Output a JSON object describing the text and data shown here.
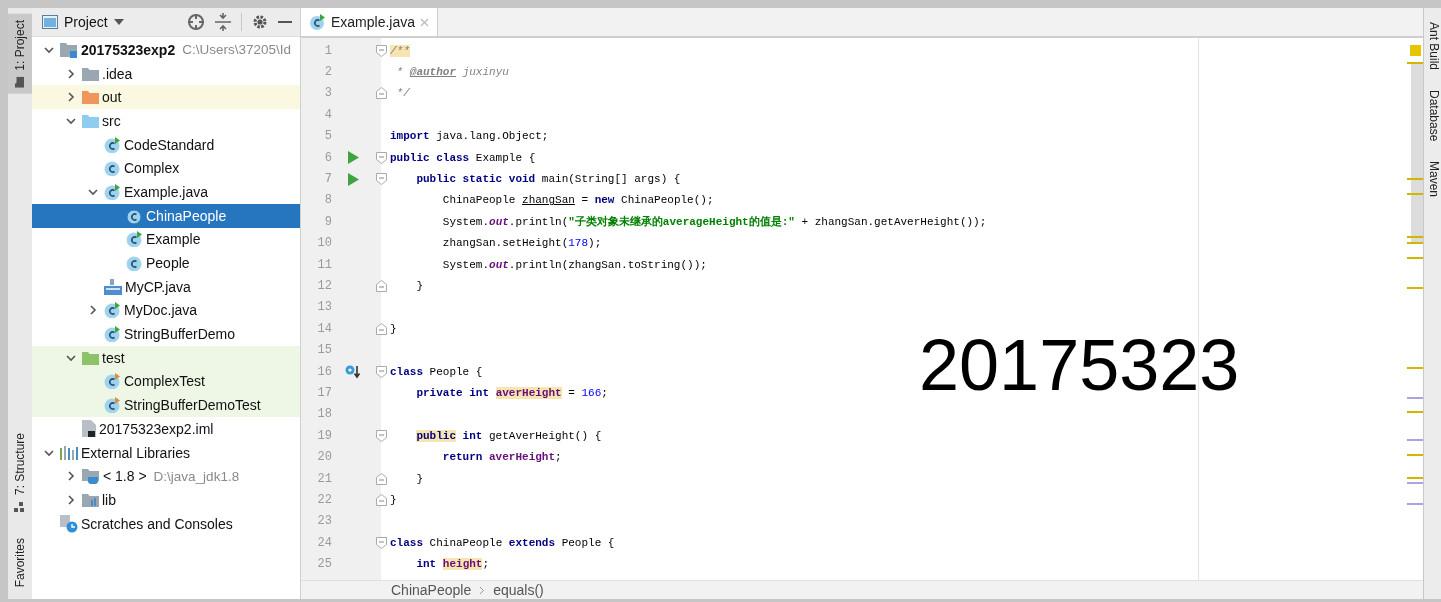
{
  "left_tool_strip": {
    "tool_windows": [
      {
        "label": "1: Project",
        "kind": "project",
        "selected": true
      },
      {
        "label": "7: Structure",
        "kind": "structure",
        "selected": false
      },
      {
        "label": "Favorites",
        "kind": "favorites",
        "selected": false
      }
    ]
  },
  "project_panel": {
    "title": "Project",
    "tree": [
      {
        "label": "20175323exp2",
        "path": "C:\\Users\\37205\\Id",
        "kind": "module",
        "expanded": true,
        "selected": false,
        "children": [
          {
            "label": ".idea",
            "kind": "folder",
            "expanded": false,
            "selected": false
          },
          {
            "label": "out",
            "kind": "folder-excluded",
            "excluded": true,
            "expanded": false,
            "selected": false
          },
          {
            "label": "src",
            "kind": "folder-src",
            "expanded": true,
            "selected": false,
            "children": [
              {
                "label": "CodeStandard",
                "kind": "class-run",
                "selected": false
              },
              {
                "label": "Complex",
                "kind": "class",
                "selected": false
              },
              {
                "label": "Example.java",
                "kind": "class-run",
                "expanded": true,
                "selected": false,
                "children": [
                  {
                    "label": "ChinaPeople",
                    "kind": "class",
                    "selected": true
                  },
                  {
                    "label": "Example",
                    "kind": "class-run",
                    "selected": false
                  },
                  {
                    "label": "People",
                    "kind": "class",
                    "selected": false
                  }
                ]
              },
              {
                "label": "MyCP.java",
                "kind": "java-file",
                "selected": false
              },
              {
                "label": "MyDoc.java",
                "kind": "class-run",
                "expanded": false,
                "selected": false
              },
              {
                "label": "StringBufferDemo",
                "kind": "class-run",
                "selected": false
              }
            ]
          },
          {
            "label": "test",
            "kind": "folder-test",
            "test_source": true,
            "expanded": true,
            "selected": false,
            "children": [
              {
                "label": "ComplexTest",
                "kind": "class-test",
                "test_source": true,
                "selected": false
              },
              {
                "label": "StringBufferDemoTest",
                "kind": "class-test",
                "test_source": true,
                "selected": false
              }
            ]
          },
          {
            "label": "20175323exp2.iml",
            "kind": "iml",
            "selected": false
          }
        ]
      },
      {
        "label": "External Libraries",
        "kind": "library",
        "expanded": true,
        "selected": false,
        "children": [
          {
            "label": "< 1.8 >",
            "path": "D:\\java_jdk1.8",
            "kind": "jdk",
            "expanded": false,
            "selected": false
          },
          {
            "label": "lib",
            "kind": "lib-folder",
            "expanded": false,
            "selected": false
          }
        ]
      },
      {
        "label": "Scratches and Consoles",
        "kind": "scratches",
        "selected": false
      }
    ]
  },
  "editor": {
    "tabs": [
      {
        "label": "Example.java",
        "selected": true
      }
    ],
    "lines": [
      {
        "n": "1",
        "fold_start": true,
        "tokens": [
          {
            "t": "/**",
            "kind": "comment",
            "hl": true
          }
        ]
      },
      {
        "n": "2",
        "tokens": [
          {
            "t": " * ",
            "kind": "comment"
          },
          {
            "t": "@author",
            "kind": "tag"
          },
          {
            "t": " juxinyu",
            "kind": "comment"
          }
        ]
      },
      {
        "n": "3",
        "fold_end": true,
        "tokens": [
          {
            "t": " */",
            "kind": "comment"
          }
        ]
      },
      {
        "n": "4"
      },
      {
        "n": "5",
        "tokens": [
          {
            "t": "import",
            "kind": "kw"
          },
          {
            "t": " java.lang.Object;",
            "kind": "plain"
          }
        ]
      },
      {
        "n": "6",
        "kind": "run",
        "fold_start": true,
        "tokens": [
          {
            "t": "public class",
            "kind": "kw"
          },
          {
            "t": " Example {",
            "kind": "plain"
          }
        ]
      },
      {
        "n": "7",
        "kind": "run",
        "fold_start": true,
        "tokens": [
          {
            "t": "    public static void",
            "kind": "kw"
          },
          {
            "t": " main(String[] args) {",
            "kind": "plain"
          }
        ]
      },
      {
        "n": "8",
        "tokens": [
          {
            "t": "        ChinaPeople ",
            "kind": "plain"
          },
          {
            "t": "zhangSan",
            "kind": "unused"
          },
          {
            "t": " = ",
            "kind": "plain"
          },
          {
            "t": "new",
            "kind": "kw"
          },
          {
            "t": " ChinaPeople();",
            "kind": "plain"
          }
        ]
      },
      {
        "n": "9",
        "tokens": [
          {
            "t": "        System.",
            "kind": "plain"
          },
          {
            "t": "out",
            "kind": "static"
          },
          {
            "t": ".println(",
            "kind": "plain"
          },
          {
            "t": "\"子类对象未继承的averageHeight的值是:\"",
            "kind": "str"
          },
          {
            "t": " + zhangSan.getAverHeight());",
            "kind": "plain"
          }
        ]
      },
      {
        "n": "10",
        "tokens": [
          {
            "t": "        zhangSan.setHeight(",
            "kind": "plain"
          },
          {
            "t": "178",
            "kind": "num"
          },
          {
            "t": ");",
            "kind": "plain"
          }
        ]
      },
      {
        "n": "11",
        "tokens": [
          {
            "t": "        System.",
            "kind": "plain"
          },
          {
            "t": "out",
            "kind": "static"
          },
          {
            "t": ".println(zhangSan.toString());",
            "kind": "plain"
          }
        ]
      },
      {
        "n": "12",
        "fold_end": true,
        "tokens": [
          {
            "t": "    }",
            "kind": "plain"
          }
        ]
      },
      {
        "n": "13"
      },
      {
        "n": "14",
        "fold_end": true,
        "tokens": [
          {
            "t": "}",
            "kind": "plain"
          }
        ]
      },
      {
        "n": "15"
      },
      {
        "n": "16",
        "kind": "override",
        "fold_start": true,
        "tokens": [
          {
            "t": "class",
            "kind": "kw"
          },
          {
            "t": " People {",
            "kind": "plain"
          }
        ]
      },
      {
        "n": "17",
        "tokens": [
          {
            "t": "    private int",
            "kind": "kw"
          },
          {
            "t": " averHeight",
            "kind": "field",
            "hl": true
          },
          {
            "t": " = ",
            "kind": "plain"
          },
          {
            "t": "166",
            "kind": "num"
          },
          {
            "t": ";",
            "kind": "plain"
          }
        ]
      },
      {
        "n": "18"
      },
      {
        "n": "19",
        "fold_start": true,
        "tokens": [
          {
            "t": "    public",
            "kind": "kw",
            "hl": true
          },
          {
            "t": " int",
            "kind": "kw"
          },
          {
            "t": " getAverHeight() {",
            "kind": "plain"
          }
        ]
      },
      {
        "n": "20",
        "tokens": [
          {
            "t": "        return",
            "kind": "kw"
          },
          {
            "t": " averHeight",
            "kind": "field"
          },
          {
            "t": ";",
            "kind": "plain"
          }
        ]
      },
      {
        "n": "21",
        "fold_end": true,
        "tokens": [
          {
            "t": "    }",
            "kind": "plain"
          }
        ]
      },
      {
        "n": "22",
        "fold_end": true,
        "tokens": [
          {
            "t": "}",
            "kind": "plain"
          }
        ]
      },
      {
        "n": "23"
      },
      {
        "n": "24",
        "fold_start": true,
        "tokens": [
          {
            "t": "class",
            "kind": "kw"
          },
          {
            "t": " ChinaPeople ",
            "kind": "plain"
          },
          {
            "t": "extends",
            "kind": "kw"
          },
          {
            "t": " People {",
            "kind": "plain"
          }
        ]
      },
      {
        "n": "25",
        "tokens": [
          {
            "t": "    int",
            "kind": "kw"
          },
          {
            "t": " height",
            "kind": "field",
            "hl": true
          },
          {
            "t": ";",
            "kind": "plain"
          }
        ]
      }
    ],
    "breadcrumbs": [
      "ChinaPeople",
      "equals()"
    ]
  },
  "overlay_text": "20175323",
  "right_tool_strip": {
    "tool_windows": [
      {
        "label": "Ant Build"
      },
      {
        "label": "Database"
      },
      {
        "label": "Maven"
      }
    ]
  }
}
